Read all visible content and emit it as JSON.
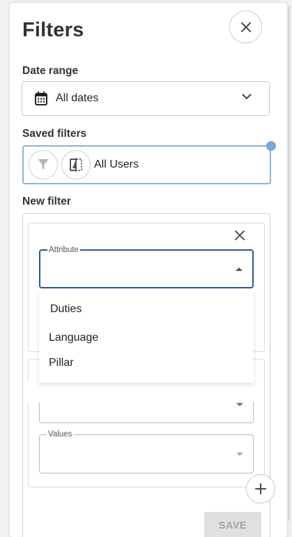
{
  "panel": {
    "title": "Filters"
  },
  "date_range": {
    "label": "Date range",
    "value": "All dates"
  },
  "saved_filters": {
    "label": "Saved filters",
    "value": "All Users"
  },
  "new_filter": {
    "label": "New filter",
    "attribute_label": "Attribute",
    "attribute_options": [
      "Duties",
      "Language",
      "Pillar"
    ],
    "values_label": "Values",
    "save_label": "SAVE"
  },
  "colors": {
    "focus_border": "#2f5596",
    "accent_dot": "#7ba7d6",
    "disabled_bg": "#e0e0e0",
    "disabled_text": "#a3a3a3"
  }
}
